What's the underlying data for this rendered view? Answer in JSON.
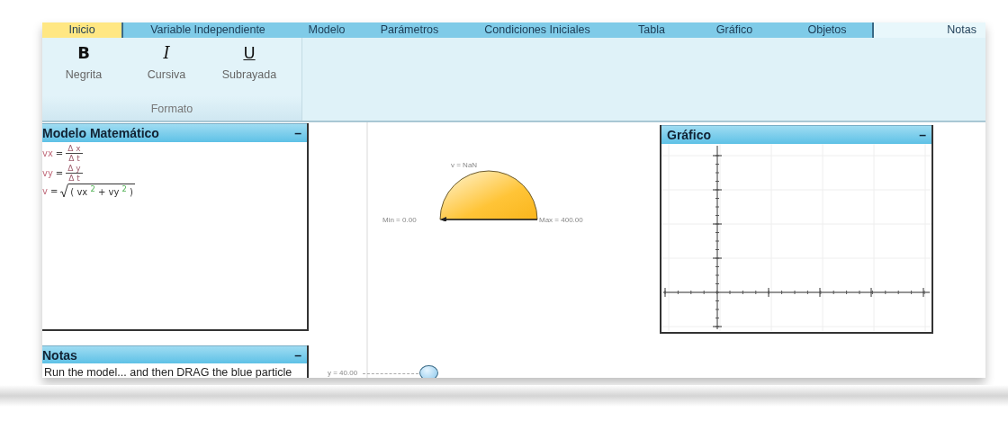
{
  "tabs": [
    {
      "label": "Inicio",
      "selected": false,
      "highlighted": true
    },
    {
      "label": "Variable Independiente",
      "selected": false,
      "highlighted": false
    },
    {
      "label": "Modelo",
      "selected": false,
      "highlighted": false
    },
    {
      "label": "Parámetros",
      "selected": false,
      "highlighted": false
    },
    {
      "label": "Condiciones Iniciales",
      "selected": false,
      "highlighted": false
    },
    {
      "label": "Tabla",
      "selected": false,
      "highlighted": false
    },
    {
      "label": "Gráfico",
      "selected": false,
      "highlighted": false
    },
    {
      "label": "Objetos",
      "selected": false,
      "highlighted": false
    },
    {
      "label": "Notas",
      "selected": true,
      "highlighted": false
    }
  ],
  "ribbon": {
    "group_label": "Formato",
    "buttons": [
      {
        "kind": "bold",
        "glyph": "B",
        "label": "Negrita"
      },
      {
        "kind": "italic",
        "glyph": "I",
        "label": "Cursiva"
      },
      {
        "kind": "underline",
        "glyph": "U",
        "label": "Subrayada"
      }
    ]
  },
  "model_panel": {
    "title": "Modelo Matemático",
    "minimize": "–",
    "equations": [
      {
        "kind": "fraction",
        "lhs": "vx",
        "eq": "=",
        "numerator": "Δ x",
        "denominator": "Δ t"
      },
      {
        "kind": "fraction",
        "lhs": "vy",
        "eq": "=",
        "numerator": "Δ y",
        "denominator": "Δ t"
      },
      {
        "kind": "sqrt",
        "lhs": "v",
        "eq": "=",
        "body": "( vx $^{2}$ + vy $^{2}$ )"
      }
    ]
  },
  "notes_panel": {
    "title": "Notas",
    "minimize": "–",
    "text": "Run the model... and then DRAG the blue particle"
  },
  "gauge": {
    "reading": "v = NaN",
    "min_label": "Min = 0.00",
    "max_label": "Max = 400.00"
  },
  "particle": {
    "label": "y = 40.00"
  },
  "graph_panel": {
    "title": "Gráfico",
    "minimize": "–"
  }
}
